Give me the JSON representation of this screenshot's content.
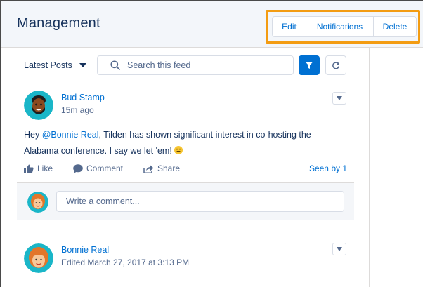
{
  "header": {
    "title": "Management",
    "buttons": {
      "edit": "Edit",
      "notifications": "Notifications",
      "delete": "Delete"
    }
  },
  "toolbar": {
    "sort_label": "Latest Posts",
    "search_placeholder": "Search this feed"
  },
  "posts": [
    {
      "author": "Bud Stamp",
      "time": "15m ago",
      "body_prefix": "Hey ",
      "mention": "@Bonnie Real",
      "body_line1": ", Tilden has shown significant interest in co-hosting the",
      "body_line2": "Alabama conference. I say we let 'em! ",
      "actions": {
        "like": "Like",
        "comment": "Comment",
        "share": "Share",
        "seen_by": "Seen by 1"
      },
      "comment_placeholder": "Write a comment..."
    },
    {
      "author": "Bonnie Real",
      "time": "Edited March 27, 2017 at 3:13 PM"
    }
  ],
  "colors": {
    "brand": "#0070d2",
    "text": "#16325c",
    "muted": "#54698d",
    "highlight": "#f39c12"
  }
}
